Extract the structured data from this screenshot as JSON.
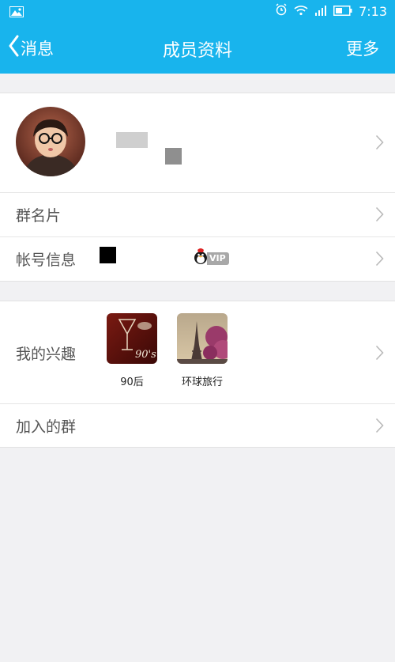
{
  "status_bar": {
    "time": "7:13"
  },
  "nav": {
    "back_label": "消息",
    "title": "成员资料",
    "more_label": "更多"
  },
  "rows": {
    "group_card_label": "群名片",
    "account_label": "帐号信息",
    "vip_badge": "VIP",
    "interests_label": "我的兴趣",
    "joined_groups_label": "加入的群"
  },
  "interests": [
    {
      "name": "90后",
      "thumb_text": "90's"
    },
    {
      "name": "环球旅行"
    }
  ],
  "colors": {
    "accent": "#18b4ed",
    "background": "#f1f1f3",
    "text": "#555555"
  }
}
